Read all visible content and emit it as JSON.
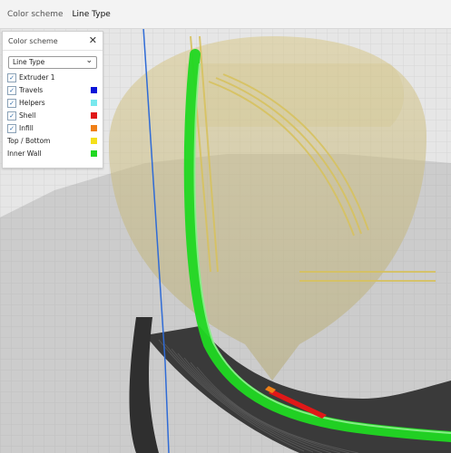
{
  "topbar": {
    "label": "Color scheme",
    "value": "Line Type"
  },
  "panel": {
    "title": "Color scheme",
    "close_icon": "close-icon",
    "select": {
      "value": "Line Type",
      "icon": "chevron-down-icon"
    },
    "rows": [
      {
        "label": "Extruder 1",
        "checked": true,
        "color": ""
      },
      {
        "label": "Travels",
        "checked": true,
        "color": "#0a14d8"
      },
      {
        "label": "Helpers",
        "checked": true,
        "color": "#78e8ee"
      },
      {
        "label": "Shell",
        "checked": true,
        "color": "#e01818"
      },
      {
        "label": "Infill",
        "checked": true,
        "color": "#f07f17"
      },
      {
        "label": "Top / Bottom",
        "checked": false,
        "color": "#f4e01a"
      },
      {
        "label": "Inner Wall",
        "checked": false,
        "color": "#20d822"
      }
    ]
  },
  "colors": {
    "grid_bg": "#e6e6e6",
    "grid_line": "#cfcfcf",
    "model_dark": "#3a3a3a",
    "support_ghost": "#cdbf7a",
    "inner_wall": "#20d822",
    "shell": "#e01818",
    "axis_line": "#2f6bd6"
  }
}
